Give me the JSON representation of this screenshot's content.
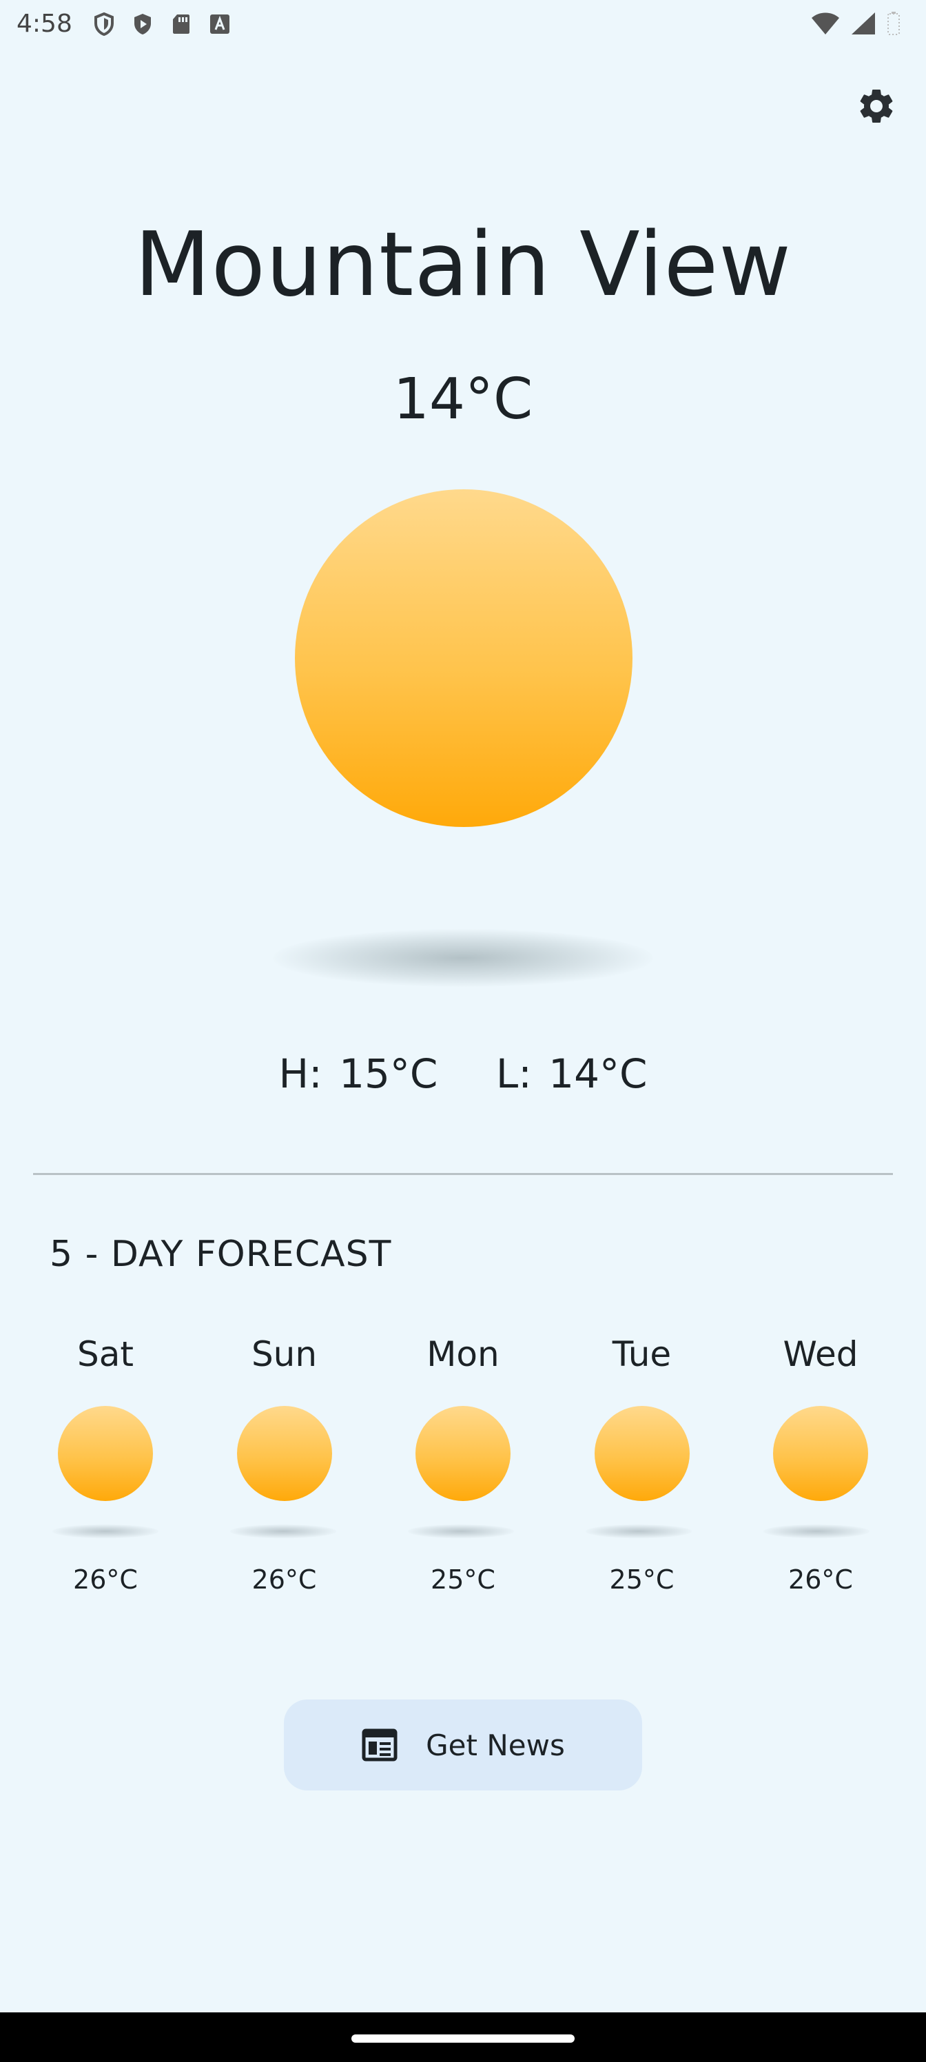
{
  "status_bar": {
    "time": "4:58",
    "left_icons": [
      "shield-icon",
      "play-shield-icon",
      "sd-card-icon",
      "font-icon"
    ],
    "right_icons": [
      "wifi-icon",
      "signal-icon",
      "battery-icon"
    ]
  },
  "header": {
    "settings_icon": "gear-icon"
  },
  "current": {
    "city": "Mountain View",
    "temperature": "14°C",
    "condition_icon": "sun-icon",
    "high": "H: 15°C",
    "low": "L: 14°C"
  },
  "forecast": {
    "title": "5 - DAY FORECAST",
    "days": [
      {
        "name": "Sat",
        "temp": "26°C",
        "icon": "sun-icon"
      },
      {
        "name": "Sun",
        "temp": "26°C",
        "icon": "sun-icon"
      },
      {
        "name": "Mon",
        "temp": "25°C",
        "icon": "sun-icon"
      },
      {
        "name": "Tue",
        "temp": "25°C",
        "icon": "sun-icon"
      },
      {
        "name": "Wed",
        "temp": "26°C",
        "icon": "sun-icon"
      }
    ]
  },
  "news_button": {
    "label": "Get News",
    "icon": "newspaper-icon"
  },
  "colors": {
    "background": "#edf7fc",
    "sun_top": "#ffd98c",
    "sun_bottom": "#ffa90a",
    "button_bg": "#dbeaf9"
  }
}
